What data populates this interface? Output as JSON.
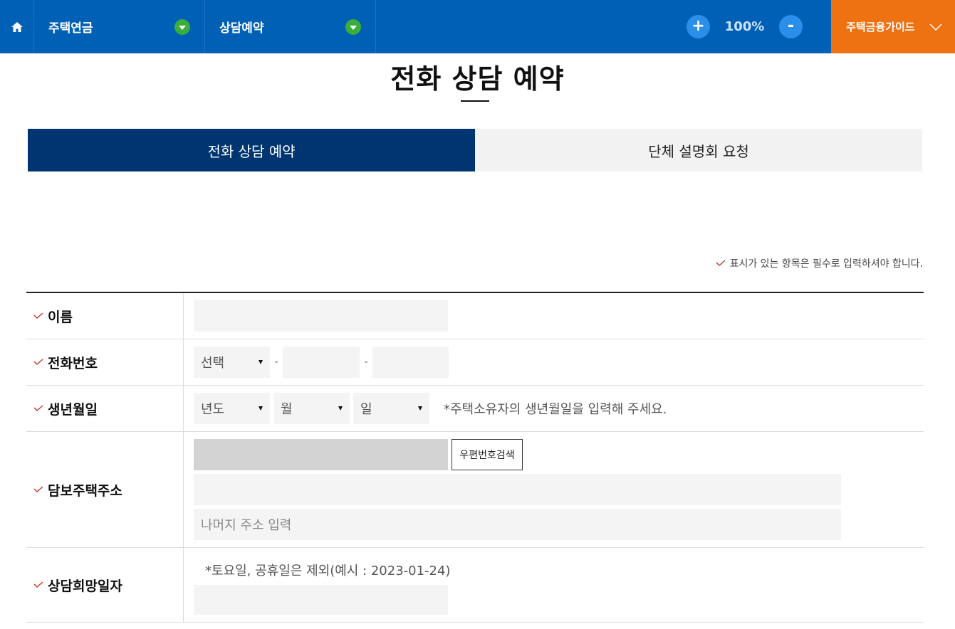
{
  "topbar": {
    "menu1": "주택연금",
    "menu2": "상담예약",
    "zoom_in": "+",
    "zoom_value": "100%",
    "zoom_out": "-",
    "guide": "주택금융가이드"
  },
  "page": {
    "title": "전화 상담 예약"
  },
  "tabs": [
    {
      "label": "전화 상담 예약",
      "active": true
    },
    {
      "label": "단체 설명회 요청",
      "active": false
    }
  ],
  "required_note": "표시가 있는 항목은 필수로 입력하셔야 합니다.",
  "form": {
    "name_label": "이름",
    "phone_label": "전화번호",
    "phone_select": "선택",
    "phone_sep": "-",
    "birth_label": "생년월일",
    "birth_year": "년도",
    "birth_month": "월",
    "birth_day": "일",
    "birth_hint": "*주택소유자의 생년월일을 입력해 주세요.",
    "address_label": "담보주택주소",
    "zip_button": "우편번호검색",
    "address_rest_placeholder": "나머지 주소 입력",
    "date_label": "상담희망일자",
    "date_hint": "*토요일, 공휴일은 제외(예시 : 2023-01-24)"
  },
  "colors": {
    "topbar": "#0060b6",
    "guide": "#ee7112",
    "tab_active": "#003572",
    "check": "#c0392b"
  },
  "icons": [
    "home-icon",
    "dropdown-icon",
    "chevron-down-icon",
    "check-icon"
  ]
}
